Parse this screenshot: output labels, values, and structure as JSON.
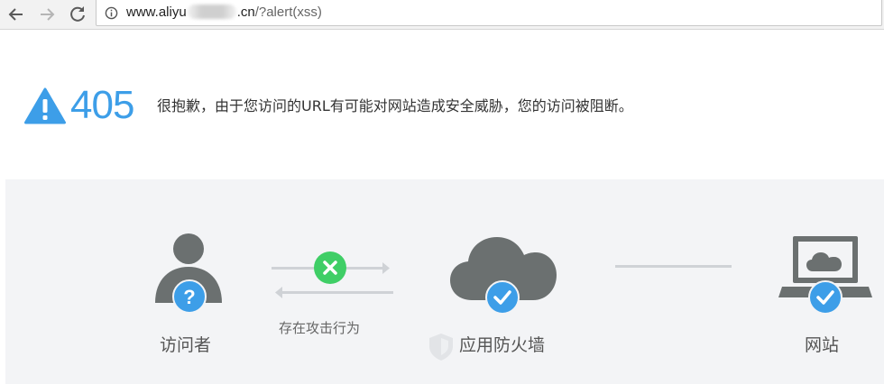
{
  "browser": {
    "url_prefix": "www.aliyu",
    "url_suffix": ".cn",
    "url_path": "/?alert(xss)"
  },
  "error": {
    "code": "405",
    "message": "很抱歉，由于您访问的URL有可能对网站造成安全威胁，您的访问被阻断。"
  },
  "flow": {
    "visitor_label": "访问者",
    "attack_label": "存在攻击行为",
    "firewall_label": "应用防火墙",
    "website_label": "网站"
  },
  "colors": {
    "accent_blue": "#3d9ee8",
    "block_green": "#3fce66",
    "icon_gray": "#6b7070",
    "panel_bg": "#f3f4f6"
  },
  "icons": {
    "back": "arrow-left-icon",
    "forward": "arrow-right-icon",
    "reload": "reload-icon",
    "info": "info-icon",
    "warning": "warning-triangle-icon",
    "visitor": "person-icon",
    "question": "question-badge-icon",
    "blocked": "x-badge-icon",
    "firewall": "cloud-icon",
    "check": "check-badge-icon",
    "shield": "shield-icon",
    "website": "laptop-icon"
  }
}
